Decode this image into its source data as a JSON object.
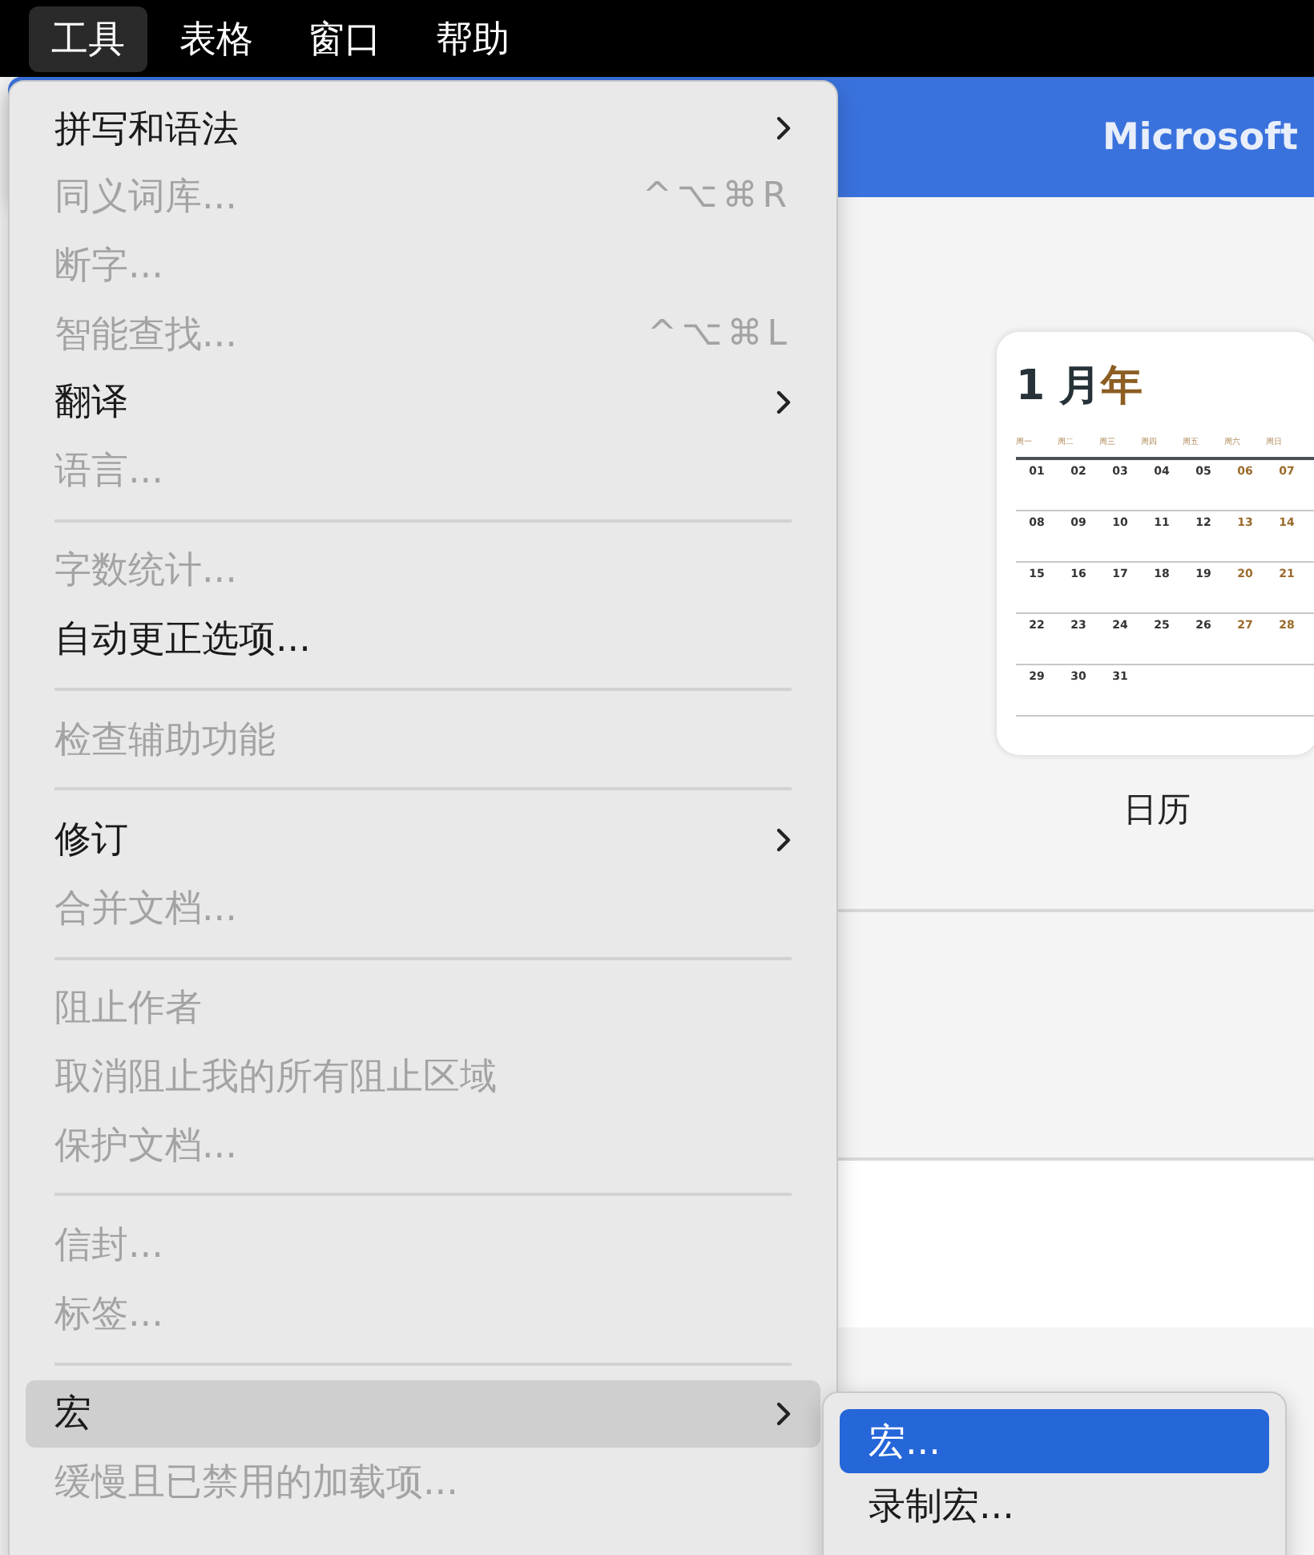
{
  "menu_bar": [
    {
      "label": "工具",
      "selected": true
    },
    {
      "label": "表格",
      "selected": false
    },
    {
      "label": "窗口",
      "selected": false
    },
    {
      "label": "帮助",
      "selected": false
    }
  ],
  "window": {
    "title": "Microsoft"
  },
  "template": {
    "label": "日历",
    "title_month": "1 月",
    "title_year": "年",
    "weekdays": [
      "周一",
      "周二",
      "周三",
      "周四",
      "周五",
      "周六",
      "周日"
    ],
    "weeks": [
      [
        "01",
        "02",
        "03",
        "04",
        "05",
        "06",
        "07"
      ],
      [
        "08",
        "09",
        "10",
        "11",
        "12",
        "13",
        "14"
      ],
      [
        "15",
        "16",
        "17",
        "18",
        "19",
        "20",
        "21"
      ],
      [
        "22",
        "23",
        "24",
        "25",
        "26",
        "27",
        "28"
      ],
      [
        "29",
        "30",
        "31"
      ]
    ]
  },
  "menu": [
    {
      "kind": "item",
      "label": "拼写和语法",
      "submenu": true,
      "disabled": false,
      "selected": false
    },
    {
      "kind": "item",
      "label": "同义词库...",
      "shortcut": "^⌥⌘R",
      "disabled": true,
      "selected": false
    },
    {
      "kind": "item",
      "label": "断字...",
      "disabled": true,
      "selected": false
    },
    {
      "kind": "item",
      "label": "智能查找...",
      "shortcut": "^⌥⌘L",
      "disabled": true,
      "selected": false
    },
    {
      "kind": "item",
      "label": "翻译",
      "submenu": true,
      "disabled": false,
      "selected": false
    },
    {
      "kind": "item",
      "label": "语言...",
      "disabled": true,
      "selected": false
    },
    {
      "kind": "separator"
    },
    {
      "kind": "item",
      "label": "字数统计...",
      "disabled": true,
      "selected": false
    },
    {
      "kind": "item",
      "label": "自动更正选项...",
      "disabled": false,
      "selected": false
    },
    {
      "kind": "separator"
    },
    {
      "kind": "item",
      "label": "检查辅助功能",
      "disabled": true,
      "selected": false
    },
    {
      "kind": "separator"
    },
    {
      "kind": "item",
      "label": "修订",
      "submenu": true,
      "disabled": false,
      "selected": false
    },
    {
      "kind": "item",
      "label": "合并文档...",
      "disabled": true,
      "selected": false
    },
    {
      "kind": "separator"
    },
    {
      "kind": "item",
      "label": "阻止作者",
      "disabled": true,
      "selected": false
    },
    {
      "kind": "item",
      "label": "取消阻止我的所有阻止区域",
      "disabled": true,
      "selected": false
    },
    {
      "kind": "item",
      "label": "保护文档...",
      "disabled": true,
      "selected": false
    },
    {
      "kind": "separator"
    },
    {
      "kind": "item",
      "label": "信封...",
      "disabled": true,
      "selected": false
    },
    {
      "kind": "item",
      "label": "标签...",
      "disabled": true,
      "selected": false
    },
    {
      "kind": "separator"
    },
    {
      "kind": "item",
      "label": "宏",
      "submenu": true,
      "disabled": false,
      "selected": true
    },
    {
      "kind": "item",
      "label": "缓慢且已禁用的加载项...",
      "disabled": true,
      "selected": false
    }
  ],
  "submenu": [
    {
      "label": "宏...",
      "selected": true
    },
    {
      "label": "录制宏...",
      "selected": false
    }
  ]
}
